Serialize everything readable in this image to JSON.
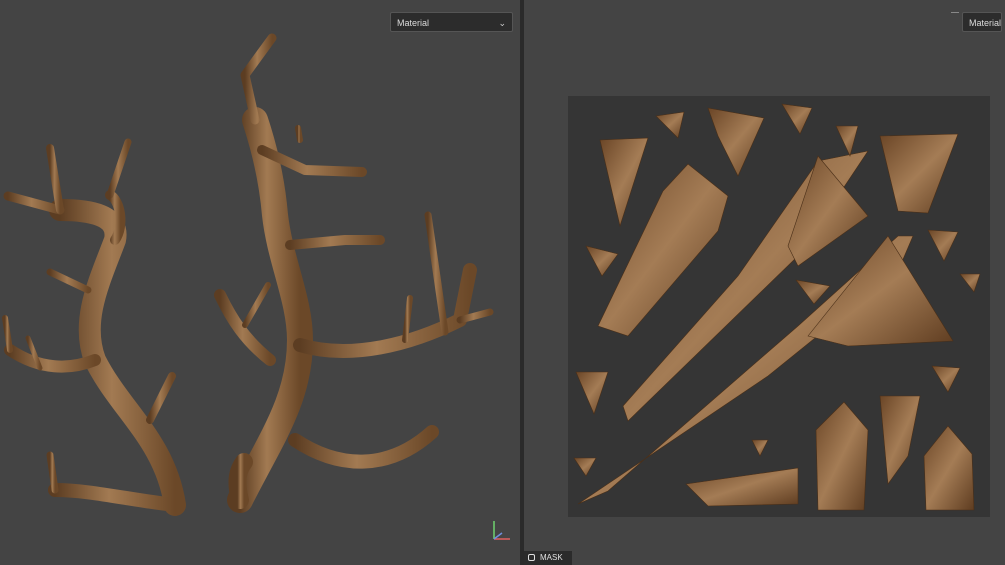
{
  "left_viewport": {
    "material_dropdown": {
      "value": "Material"
    }
  },
  "right_viewport": {
    "material_dropdown": {
      "value": "Material"
    }
  },
  "footer": {
    "mask_label": "MASK"
  },
  "colors": {
    "viewport_bg": "#444444",
    "uv_bg": "#353535",
    "wood_dark": "#5c3d22",
    "wood_mid": "#8a6440",
    "wood_light": "#b08660"
  },
  "icons": [
    "chevron-down-icon",
    "axis-gizmo-icon",
    "mask-icon"
  ]
}
